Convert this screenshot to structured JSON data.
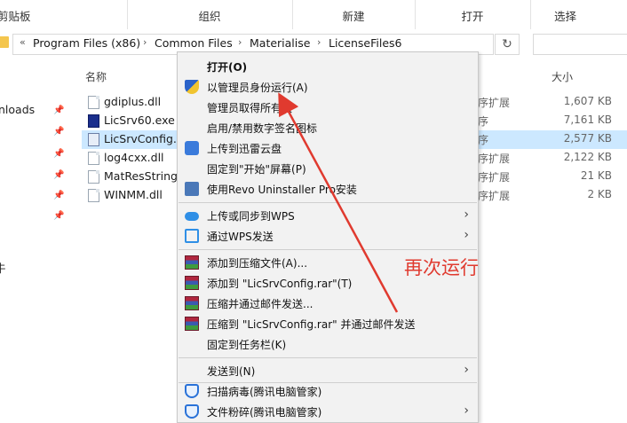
{
  "ribbon": {
    "groups": [
      "剪贴板",
      "组织",
      "新建",
      "打开",
      "选择"
    ]
  },
  "address": {
    "chevron": "«",
    "crumbs": [
      "Program Files (x86)",
      "Common Files",
      "Materialise",
      "LicenseFiles6"
    ],
    "separator": "›"
  },
  "nav": {
    "partial_item": "nloads",
    "partial_item2": "牛"
  },
  "columns": {
    "name": "名称",
    "size": "大小"
  },
  "files": [
    {
      "name": "gdiplus.dll",
      "type": "序扩展",
      "size": "1,607 KB",
      "icon": "dll-file-icon"
    },
    {
      "name": "LicSrv60.exe",
      "type": "序",
      "size": "7,161 KB",
      "icon": "exe-file-icon"
    },
    {
      "name": "LicSrvConfig.e",
      "type": "序",
      "size": "2,577 KB",
      "icon": "config-exe-icon",
      "selected": true
    },
    {
      "name": "log4cxx.dll",
      "type": "序扩展",
      "size": "2,122 KB",
      "icon": "dll-file-icon"
    },
    {
      "name": "MatResString.",
      "type": "序扩展",
      "size": "21 KB",
      "icon": "dll-file-icon"
    },
    {
      "name": "WINMM.dll",
      "type": "序扩展",
      "size": "2 KB",
      "icon": "dll-file-icon"
    }
  ],
  "menu": {
    "open": "打开(O)",
    "run_as_admin": "以管理员身份运行(A)",
    "take_ownership": "管理员取得所有权",
    "toggle_signature": "启用/禁用数字签名图标",
    "upload_xunlei": "上传到迅雷云盘",
    "pin_start": "固定到\"开始\"屏幕(P)",
    "revo": "使用Revo Uninstaller Pro安装",
    "wps_sync": "上传或同步到WPS",
    "wps_send": "通过WPS发送",
    "add_archive": "添加到压缩文件(A)...",
    "add_rar": "添加到 \"LicSrvConfig.rar\"(T)",
    "compress_email": "压缩并通过邮件发送...",
    "compress_rar_email": "压缩到 \"LicSrvConfig.rar\" 并通过邮件发送",
    "pin_taskbar": "固定到任务栏(K)",
    "send_to": "发送到(N)",
    "scan_virus": "扫描病毒(腾讯电脑管家)",
    "shred": "文件粉碎(腾讯电脑管家)",
    "submenu_arrow": "›"
  },
  "annotation": {
    "text": "再次运行",
    "color": "#e03a2f"
  },
  "colors": {
    "selection": "#cce8ff",
    "menu_bg": "#f2f2f2",
    "accent": "#2b63c9"
  }
}
